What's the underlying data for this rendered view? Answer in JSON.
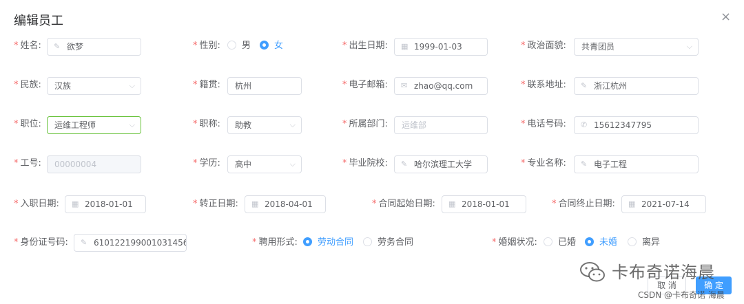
{
  "dialog": {
    "title": "编辑员工",
    "close_glyph": "×"
  },
  "fields": {
    "name": {
      "label": "姓名:",
      "value": "欲梦"
    },
    "gender": {
      "label": "性别:",
      "options": [
        "男",
        "女"
      ],
      "selected": "女"
    },
    "birthday": {
      "label": "出生日期:",
      "value": "1999-01-03"
    },
    "politic": {
      "label": "政治面貌:",
      "value": "共青团员"
    },
    "nation": {
      "label": "民族:",
      "value": "汉族"
    },
    "native_place": {
      "label": "籍贯:",
      "value": "杭州"
    },
    "email": {
      "label": "电子邮箱:",
      "value": "zhao@qq.com"
    },
    "address": {
      "label": "联系地址:",
      "value": "浙江杭州"
    },
    "position": {
      "label": "职位:",
      "value": "运维工程师"
    },
    "job_level": {
      "label": "职称:",
      "value": "助教"
    },
    "department": {
      "label": "所属部门:",
      "placeholder": "运维部"
    },
    "phone": {
      "label": "电话号码:",
      "value": "15612347795"
    },
    "work_id": {
      "label": "工号:",
      "value": "00000004"
    },
    "education": {
      "label": "学历:",
      "value": "高中"
    },
    "school": {
      "label": "毕业院校:",
      "value": "哈尔滨理工大学"
    },
    "specialty": {
      "label": "专业名称:",
      "value": "电子工程"
    },
    "begin_date": {
      "label": "入职日期:",
      "value": "2018-01-01"
    },
    "conversion_time": {
      "label": "转正日期:",
      "value": "2018-04-01"
    },
    "contract_begin": {
      "label": "合同起始日期:",
      "value": "2018-01-01"
    },
    "contract_end": {
      "label": "合同终止日期:",
      "value": "2021-07-14"
    },
    "id_card": {
      "label": "身份证号码:",
      "value": "610122199001031456"
    },
    "engage_form": {
      "label": "聘用形式:",
      "options": [
        "劳动合同",
        "劳务合同"
      ],
      "selected": "劳动合同"
    },
    "wedlock": {
      "label": "婚姻状况:",
      "options": [
        "已婚",
        "未婚",
        "离异"
      ],
      "selected": "未婚"
    }
  },
  "required_mark": "*",
  "icons": {
    "edit": "✎",
    "calendar": "▦",
    "mail": "✉",
    "phone": "✆",
    "chevron": "⌵"
  },
  "buttons": {
    "cancel": "取 消",
    "confirm": "确 定"
  },
  "watermark": {
    "account": "卡布奇诺海晨",
    "credit": "CSDN @卡布奇诺 海晨"
  },
  "colors": {
    "primary": "#409eff",
    "required": "#f56c6c",
    "focus": "#67c23a",
    "border": "#dcdfe6"
  }
}
